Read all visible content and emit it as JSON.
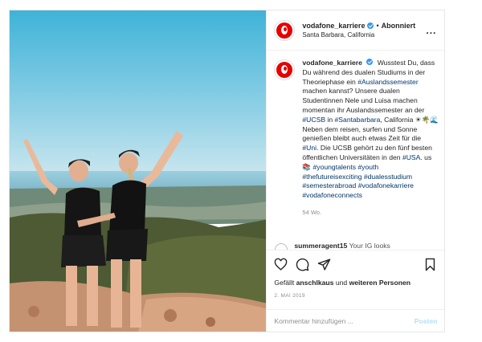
{
  "header": {
    "username": "vodafone_karriere",
    "separator": "•",
    "follow_status": "Abonniert",
    "location": "Santa Barbara, California",
    "more": "..."
  },
  "caption": {
    "username": "vodafone_karriere",
    "segments": [
      {
        "t": "Wusstest Du, dass Du während des dualen Studiums in der Theoriephase ein ",
        "tag": false
      },
      {
        "t": "#Auslandssemester",
        "tag": true
      },
      {
        "t": " machen kannst? Unsere dualen Studentinnen Nele und Luisa machen momentan ihr Auslandssemester an der ",
        "tag": false
      },
      {
        "t": "#UCSB",
        "tag": true
      },
      {
        "t": " in ",
        "tag": false
      },
      {
        "t": "#Santabarbara",
        "tag": true
      },
      {
        "t": ", California ☀🌴🌊 Neben dem reisen, surfen und Sonne genießen bleibt auch etwas Zeit für die ",
        "tag": false
      },
      {
        "t": "#Uni",
        "tag": true
      },
      {
        "t": ". Die UCSB gehört zu den fünf besten öffentlichen Universitäten in den ",
        "tag": false
      },
      {
        "t": "#USA",
        "tag": true
      },
      {
        "t": ". us📚 ",
        "tag": false
      },
      {
        "t": "#youngtalents",
        "tag": true
      },
      {
        "t": " ",
        "tag": false
      },
      {
        "t": "#youth",
        "tag": true
      },
      {
        "t": " ",
        "tag": false
      },
      {
        "t": "#thefutureisexciting",
        "tag": true
      },
      {
        "t": " ",
        "tag": false
      },
      {
        "t": "#dualesstudium",
        "tag": true
      },
      {
        "t": " ",
        "tag": false
      },
      {
        "t": "#semesterabroad",
        "tag": true
      },
      {
        "t": " ",
        "tag": false
      },
      {
        "t": "#vodafonekarriere",
        "tag": true
      },
      {
        "t": " ",
        "tag": false
      },
      {
        "t": "#vodafoneconnects",
        "tag": true
      }
    ],
    "age": "54 Wo."
  },
  "comment_peek": {
    "username": "summeragent15",
    "text": "Your IG looks"
  },
  "likes": {
    "prefix": "Gefällt ",
    "user": "anschlkaus",
    "middle": " und ",
    "others": "weiteren Personen"
  },
  "date": "2. MAI 2019",
  "comment_box": {
    "placeholder": "Kommentar hinzufügen ...",
    "post_label": "Posten"
  },
  "colors": {
    "brand_red": "#e60000",
    "hashtag": "#00376b",
    "verified": "#3897f0",
    "muted": "#8e8e8e"
  },
  "icons": [
    "heart-icon",
    "comment-icon",
    "share-icon",
    "bookmark-icon",
    "more-icon",
    "verified-icon"
  ]
}
